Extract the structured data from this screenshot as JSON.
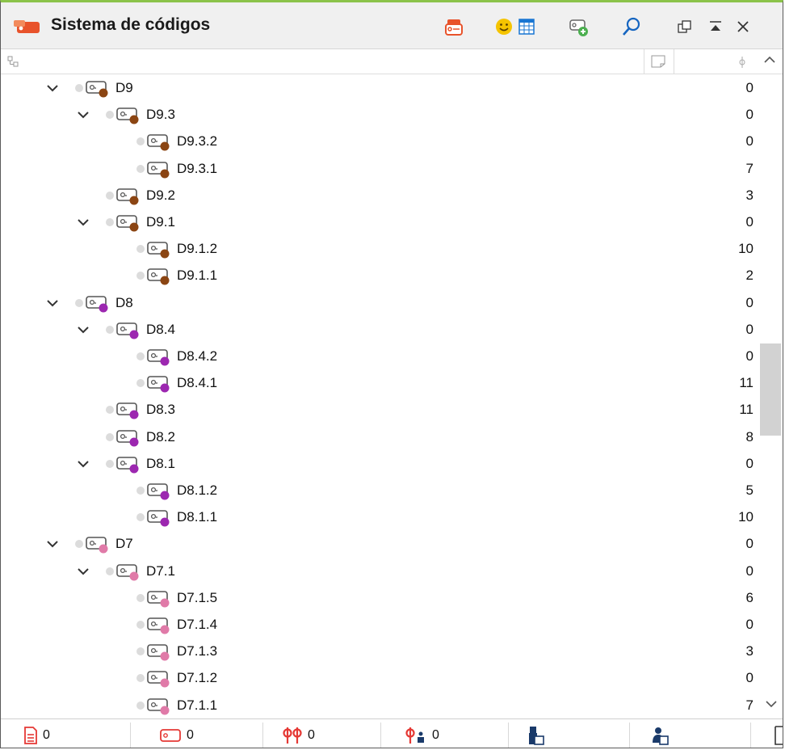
{
  "window": {
    "title": "Sistema de códigos",
    "app_icon": "code-system-icon",
    "accent_color": "#e8532b",
    "toolbar_icons": [
      "code-set-icon",
      "smiley-icon",
      "table-icon",
      "new-code-icon",
      "search-icon",
      "undock-icon",
      "collapse-icon",
      "close-icon"
    ]
  },
  "columns": {
    "tree_icon": "tree-toggle-icon",
    "memo_icon": "memo-column-icon",
    "count_icon": "frequency-column-icon"
  },
  "colors": {
    "D9": "#8b4513",
    "D8": "#9c27b0",
    "D7": "#e07aa8"
  },
  "rows": [
    {
      "label": "D9",
      "count": "0",
      "level": 0,
      "expandable": true,
      "color": "#8b4513"
    },
    {
      "label": "D9.3",
      "count": "0",
      "level": 1,
      "expandable": true,
      "color": "#8b4513"
    },
    {
      "label": "D9.3.2",
      "count": "0",
      "level": 2,
      "expandable": false,
      "color": "#8b4513"
    },
    {
      "label": "D9.3.1",
      "count": "7",
      "level": 2,
      "expandable": false,
      "color": "#8b4513"
    },
    {
      "label": "D9.2",
      "count": "3",
      "level": 1,
      "expandable": false,
      "color": "#8b4513"
    },
    {
      "label": "D9.1",
      "count": "0",
      "level": 1,
      "expandable": true,
      "color": "#8b4513"
    },
    {
      "label": "D9.1.2",
      "count": "10",
      "level": 2,
      "expandable": false,
      "color": "#8b4513"
    },
    {
      "label": "D9.1.1",
      "count": "2",
      "level": 2,
      "expandable": false,
      "color": "#8b4513"
    },
    {
      "label": "D8",
      "count": "0",
      "level": 0,
      "expandable": true,
      "color": "#9c27b0"
    },
    {
      "label": "D8.4",
      "count": "0",
      "level": 1,
      "expandable": true,
      "color": "#9c27b0"
    },
    {
      "label": "D8.4.2",
      "count": "0",
      "level": 2,
      "expandable": false,
      "color": "#9c27b0"
    },
    {
      "label": "D8.4.1",
      "count": "11",
      "level": 2,
      "expandable": false,
      "color": "#9c27b0"
    },
    {
      "label": "D8.3",
      "count": "11",
      "level": 1,
      "expandable": false,
      "color": "#9c27b0"
    },
    {
      "label": "D8.2",
      "count": "8",
      "level": 1,
      "expandable": false,
      "color": "#9c27b0"
    },
    {
      "label": "D8.1",
      "count": "0",
      "level": 1,
      "expandable": true,
      "color": "#9c27b0"
    },
    {
      "label": "D8.1.2",
      "count": "5",
      "level": 2,
      "expandable": false,
      "color": "#9c27b0"
    },
    {
      "label": "D8.1.1",
      "count": "10",
      "level": 2,
      "expandable": false,
      "color": "#9c27b0"
    },
    {
      "label": "D7",
      "count": "0",
      "level": 0,
      "expandable": true,
      "color": "#e07aa8"
    },
    {
      "label": "D7.1",
      "count": "0",
      "level": 1,
      "expandable": true,
      "color": "#e07aa8"
    },
    {
      "label": "D7.1.5",
      "count": "6",
      "level": 2,
      "expandable": false,
      "color": "#e07aa8"
    },
    {
      "label": "D7.1.4",
      "count": "0",
      "level": 2,
      "expandable": false,
      "color": "#e07aa8"
    },
    {
      "label": "D7.1.3",
      "count": "3",
      "level": 2,
      "expandable": false,
      "color": "#e07aa8"
    },
    {
      "label": "D7.1.2",
      "count": "0",
      "level": 2,
      "expandable": false,
      "color": "#e07aa8"
    },
    {
      "label": "D7.1.1",
      "count": "7",
      "level": 2,
      "expandable": false,
      "color": "#e07aa8"
    }
  ],
  "statusbar": {
    "documents_count": "0",
    "coded_segments_count": "0",
    "codes_count": "0",
    "code_relations_count": "0"
  }
}
